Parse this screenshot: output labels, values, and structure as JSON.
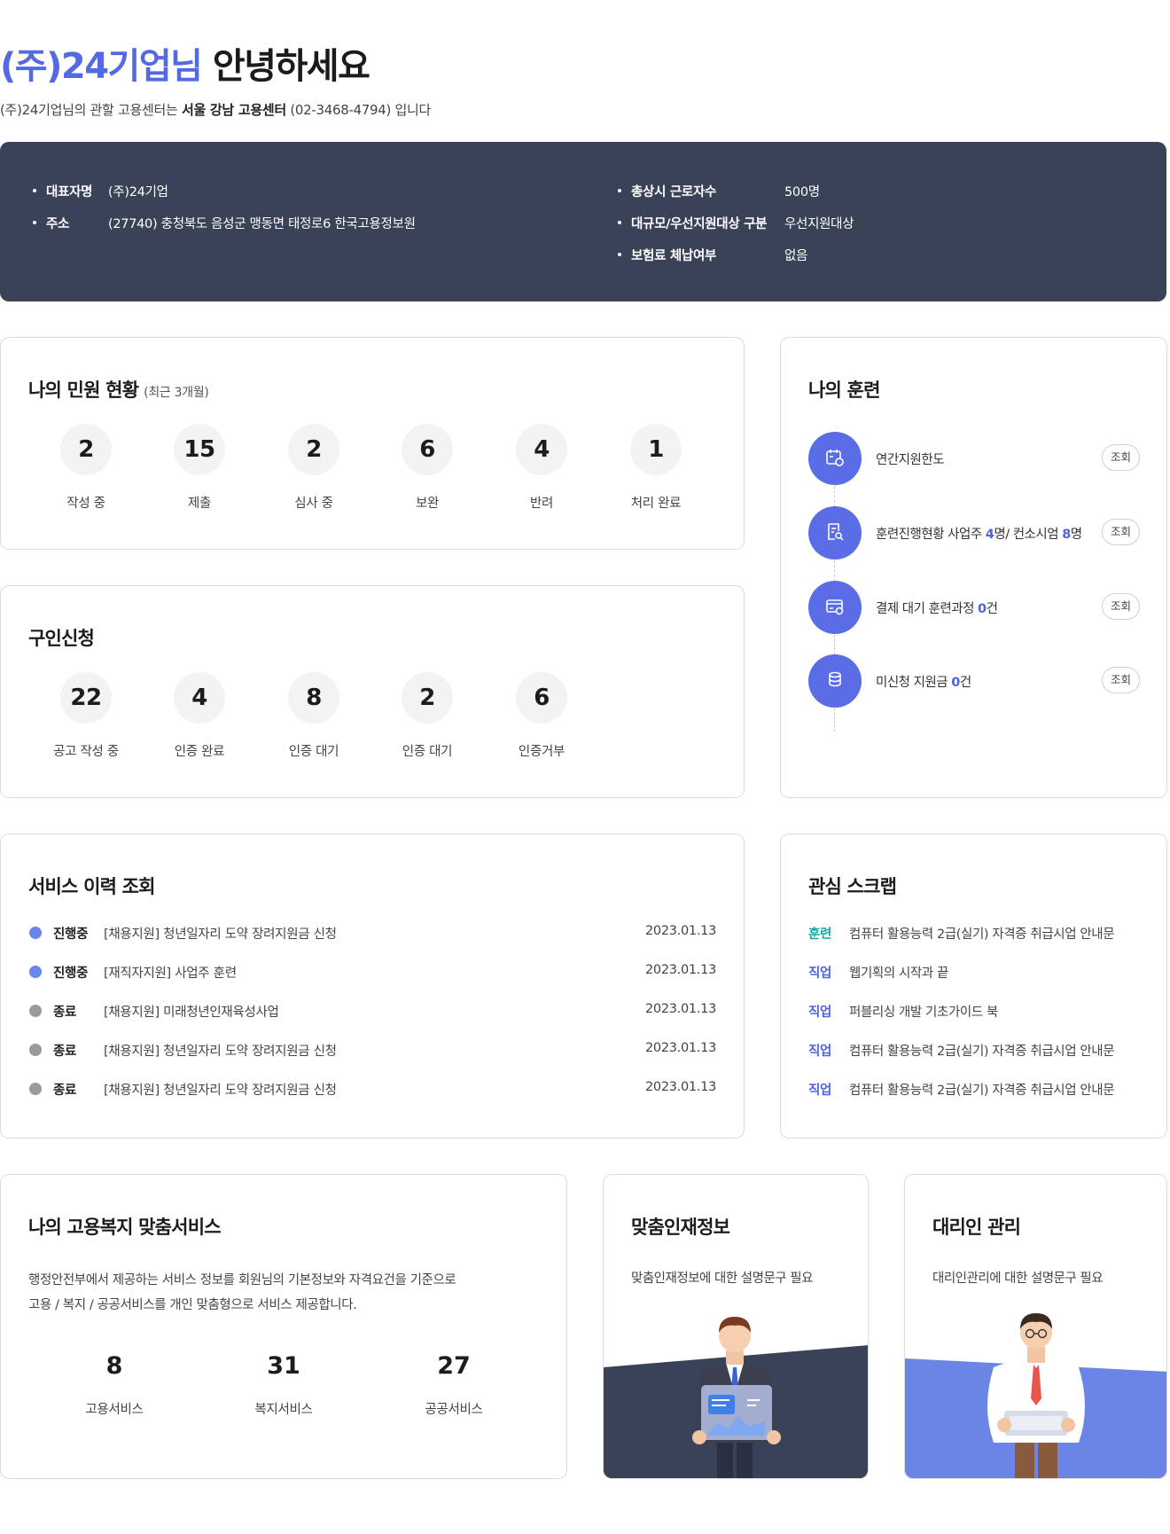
{
  "greeting": {
    "company": "(주)24기업님",
    "hello": "안녕하세요",
    "sub_prefix": "(주)24기업님의 관할 고용센터는 ",
    "center": "서울 강남 고용센터",
    "sub_suffix": " (02-3468-4794) 입니다"
  },
  "company_info": {
    "left": [
      {
        "label": "대표자명",
        "value": "(주)24기업"
      },
      {
        "label": "주소",
        "value": "(27740) 충청북도 음성군 맹동면 태정로6 한국고용정보원"
      }
    ],
    "right": [
      {
        "label": "총상시 근로자수",
        "value": "500명"
      },
      {
        "label": "대규모/우선지원대상 구분",
        "value": "우선지원대상"
      },
      {
        "label": "보험료 체납여부",
        "value": "없음"
      }
    ]
  },
  "complaints": {
    "title": "나의 민원 현황",
    "subtitle": "(최근 3개월)",
    "stats": [
      {
        "value": "2",
        "label": "작성 중"
      },
      {
        "value": "15",
        "label": "제출"
      },
      {
        "value": "2",
        "label": "심사 중"
      },
      {
        "value": "6",
        "label": "보완"
      },
      {
        "value": "4",
        "label": "반려"
      },
      {
        "value": "1",
        "label": "처리 완료"
      }
    ]
  },
  "recruit": {
    "title": "구인신청",
    "stats": [
      {
        "value": "22",
        "label": "공고 작성 중"
      },
      {
        "value": "4",
        "label": "인증 완료"
      },
      {
        "value": "8",
        "label": "인증 대기"
      },
      {
        "value": "2",
        "label": "인증 대기"
      },
      {
        "value": "6",
        "label": "인증거부"
      }
    ]
  },
  "training": {
    "title": "나의 훈련",
    "button_label": "조회",
    "items": [
      {
        "icon": "calendar-icon",
        "text": "연간지원한도"
      },
      {
        "icon": "document-search-icon",
        "text_a": "훈련진행현황  사업주 ",
        "num_a": "4",
        "text_b": "명/ 컨소시엄 ",
        "num_b": "8",
        "text_c": "명"
      },
      {
        "icon": "card-icon",
        "text": "결제 대기 훈련과정  ",
        "num": "0",
        "unit": "건"
      },
      {
        "icon": "coins-icon",
        "text": "미신청 지원금  ",
        "num": "0",
        "unit": "건"
      }
    ]
  },
  "history": {
    "title": "서비스 이력 조회",
    "rows": [
      {
        "status": "진행중",
        "active": true,
        "text": "[채용지원] 청년일자리 도약 장려지원금 신청",
        "date": "2023.01.13"
      },
      {
        "status": "진행중",
        "active": true,
        "text": "[재직자지원] 사업주 훈련",
        "date": "2023.01.13"
      },
      {
        "status": "종료",
        "active": false,
        "text": "[채용지원] 미래청년인재육성사업",
        "date": "2023.01.13"
      },
      {
        "status": "종료",
        "active": false,
        "text": "[채용지원] 청년일자리 도약 장려지원금 신청",
        "date": "2023.01.13"
      },
      {
        "status": "종료",
        "active": false,
        "text": "[채용지원] 청년일자리 도약 장려지원금 신청",
        "date": "2023.01.13"
      }
    ]
  },
  "scrap": {
    "title": "관심 스크랩",
    "rows": [
      {
        "category": "훈련",
        "text": "컴퓨터 활용능력 2급(실기) 자격증 취급시업 안내문"
      },
      {
        "category": "직업",
        "text": "웹기획의 시작과 끝"
      },
      {
        "category": "직업",
        "text": "퍼블리싱 개발 기초가이드 북"
      },
      {
        "category": "직업",
        "text": "컴퓨터 활용능력 2급(실기) 자격증 취급시업 안내문"
      },
      {
        "category": "직업",
        "text": "컴퓨터 활용능력 2급(실기) 자격증 취급시업 안내문"
      }
    ]
  },
  "welfare": {
    "title": "나의 고용복지 맞춤서비스",
    "desc_line1": "행정안전부에서 제공하는 서비스 정보를 회원님의 기본정보와 자격요건을 기준으로",
    "desc_line2": "고용 / 복지 / 공공서비스를 개인 맞춤형으로 서비스 제공합니다.",
    "stats": [
      {
        "value": "8",
        "label": "고용서비스"
      },
      {
        "value": "31",
        "label": "복지서비스"
      },
      {
        "value": "27",
        "label": "공공서비스"
      }
    ]
  },
  "talent": {
    "title": "맞춤인재정보",
    "desc": "맞춤인재정보에 대한 설명문구 필요"
  },
  "agent": {
    "title": "대리인 관리",
    "desc": "대리인관리에 대한 설명문구 필요"
  },
  "colors": {
    "accent": "#5469e4",
    "navy": "#3a4257",
    "training_cat": "#1aa7a0",
    "job_cat": "#4f63e0",
    "active_dot": "#6b85ef",
    "inactive_dot": "#9a9a9a"
  }
}
